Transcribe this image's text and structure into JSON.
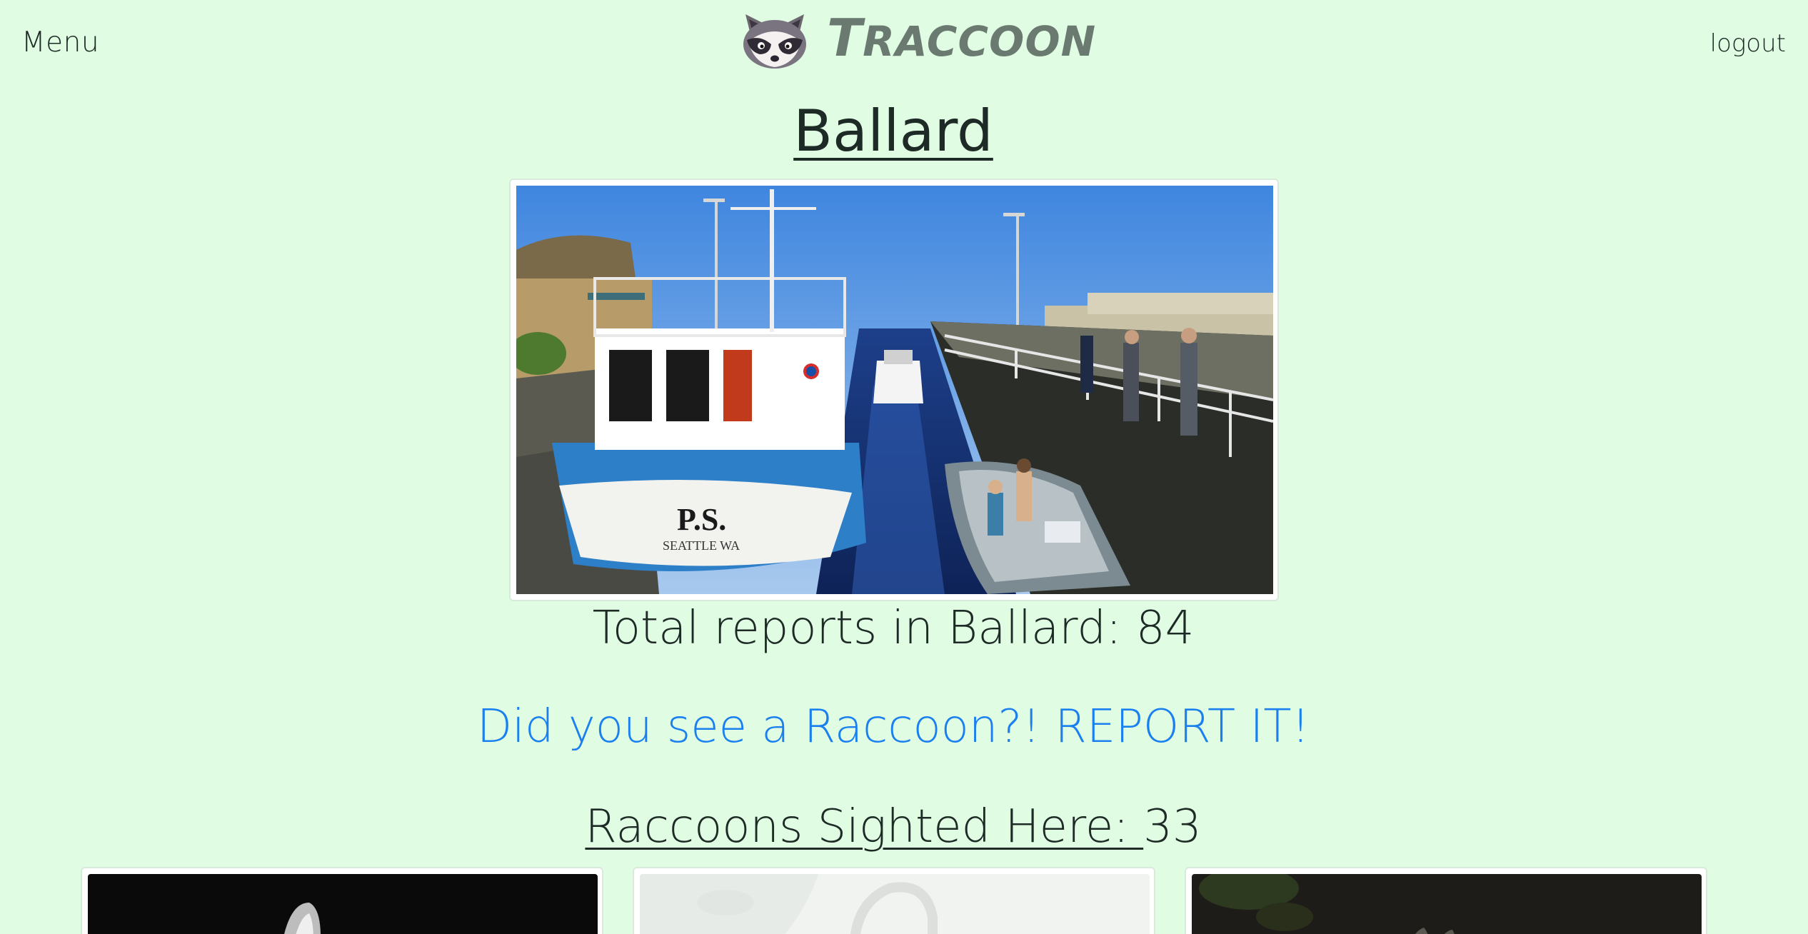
{
  "nav": {
    "menu_label": "Menu",
    "logout_label": "logout",
    "brand_icon": "raccoon-face-icon",
    "brand_first": "T",
    "brand_rest": "RACCOON"
  },
  "neighborhood": {
    "name": "Ballard",
    "total_reports_text": "Total reports in Ballard: 84",
    "report_prompt": "Did you see a Raccoon?! REPORT IT!",
    "sighted_label": "Raccoons Sighted Here: ",
    "sighted_count": "33"
  },
  "hero_photo": {
    "hull_text": "P.S.",
    "hull_subtext": "SEATTLE WA"
  },
  "colors": {
    "background": "#e0fde3",
    "link": "#1a80f0",
    "brand": "#6b7a70"
  }
}
